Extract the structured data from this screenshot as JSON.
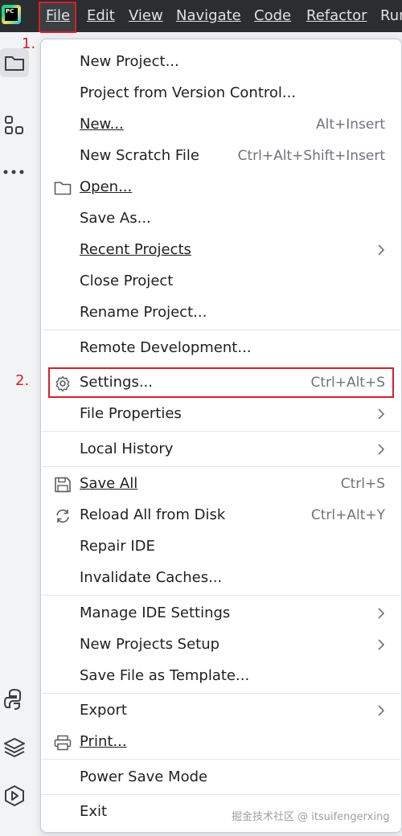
{
  "menubar": {
    "items": [
      {
        "label": "File",
        "mnemonic_index": 0
      },
      {
        "label": "Edit",
        "mnemonic_index": 0
      },
      {
        "label": "View",
        "mnemonic_index": 0
      },
      {
        "label": "Navigate",
        "mnemonic_index": 0
      },
      {
        "label": "Code",
        "mnemonic_index": 0
      },
      {
        "label": "Refactor",
        "mnemonic_index": 0
      },
      {
        "label": "Run",
        "mnemonic_index": 1
      }
    ],
    "logo_text": "PC"
  },
  "annotations": {
    "step1": "1.",
    "step2": "2."
  },
  "file_menu": {
    "items": [
      {
        "label": "New Project...",
        "shortcut": "",
        "submenu": false
      },
      {
        "label": "Project from Version Control...",
        "shortcut": "",
        "submenu": false
      },
      {
        "label": "New...",
        "shortcut": "Alt+Insert",
        "submenu": false
      },
      {
        "label": "New Scratch File",
        "shortcut": "Ctrl+Alt+Shift+Insert",
        "submenu": false
      },
      {
        "label": "Open...",
        "shortcut": "",
        "submenu": false,
        "icon": "folder-icon"
      },
      {
        "label": "Save As...",
        "shortcut": "",
        "submenu": false
      },
      {
        "label": "Recent Projects",
        "shortcut": "",
        "submenu": true
      },
      {
        "label": "Close Project",
        "shortcut": "",
        "submenu": false
      },
      {
        "label": "Rename Project...",
        "shortcut": "",
        "submenu": false
      },
      {
        "label": "Remote Development...",
        "shortcut": "",
        "submenu": false
      },
      {
        "label": "Settings...",
        "shortcut": "Ctrl+Alt+S",
        "submenu": false,
        "icon": "gear-icon"
      },
      {
        "label": "File Properties",
        "shortcut": "",
        "submenu": true
      },
      {
        "label": "Local History",
        "shortcut": "",
        "submenu": true
      },
      {
        "label": "Save All",
        "shortcut": "Ctrl+S",
        "submenu": false,
        "icon": "save-icon"
      },
      {
        "label": "Reload All from Disk",
        "shortcut": "Ctrl+Alt+Y",
        "submenu": false,
        "icon": "reload-icon"
      },
      {
        "label": "Repair IDE",
        "shortcut": "",
        "submenu": false
      },
      {
        "label": "Invalidate Caches...",
        "shortcut": "",
        "submenu": false
      },
      {
        "label": "Manage IDE Settings",
        "shortcut": "",
        "submenu": true
      },
      {
        "label": "New Projects Setup",
        "shortcut": "",
        "submenu": true
      },
      {
        "label": "Save File as Template...",
        "shortcut": "",
        "submenu": false
      },
      {
        "label": "Export",
        "shortcut": "",
        "submenu": true
      },
      {
        "label": "Print...",
        "shortcut": "",
        "submenu": false,
        "icon": "print-icon"
      },
      {
        "label": "Power Save Mode",
        "shortcut": "",
        "submenu": false
      },
      {
        "label": "Exit",
        "shortcut": "",
        "submenu": false
      }
    ]
  },
  "watermark": "掘金技术社区 @ itsuifengerxing",
  "colors": {
    "annotation_red": "#d4202a",
    "menubar_bg": "#2b2d30",
    "menu_bg": "#ffffff"
  }
}
